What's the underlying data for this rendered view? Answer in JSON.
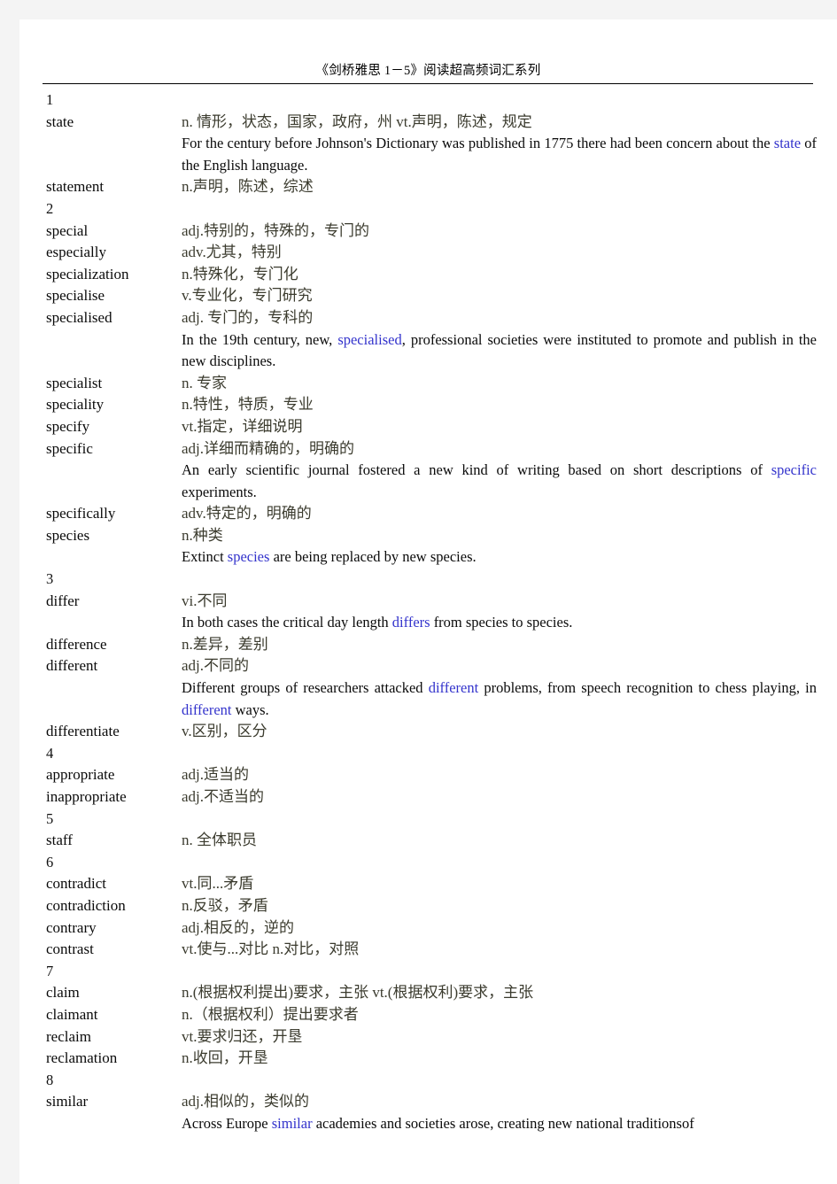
{
  "header": {
    "title": "《剑桥雅思 1－5》阅读超高频词汇系列"
  },
  "colors": {
    "page_background": "#ffffff",
    "outer_margin": "#f4f4f4",
    "highlight_word": "#3333cc",
    "chinese_definition": "#4a4a33",
    "body_text": "#0a0a0a"
  },
  "groups": [
    {
      "number": "1",
      "entries": [
        {
          "word": "state",
          "definition": "n. 情形，状态，国家，政府，州  vt.声明，陈述，规定",
          "examples": [
            {
              "before": "For the century before Johnson's Dictionary was published in 1775 there had been concern about the ",
              "highlight": "state",
              "after": " of the English language.",
              "justify": true
            }
          ]
        },
        {
          "word": "statement",
          "definition": "n.声明，陈述，综述",
          "examples": []
        }
      ]
    },
    {
      "number": "2",
      "entries": [
        {
          "word": "special",
          "definition": "adj.特别的，特殊的，专门的",
          "examples": []
        },
        {
          "word": "especially",
          "definition": "adv.尤其，特别",
          "examples": []
        },
        {
          "word": "specialization",
          "definition": "n.特殊化，专门化",
          "examples": []
        },
        {
          "word": "specialise",
          "definition": "v.专业化，专门研究",
          "examples": []
        },
        {
          "word": "specialised",
          "definition": "adj. 专门的，专科的",
          "examples": [
            {
              "before": "In the 19th century, new, ",
              "highlight": "specialised",
              "after": ", professional societies were instituted to promote and publish in the new disciplines.",
              "justify": true
            }
          ]
        },
        {
          "word": "specialist",
          "definition": "n. 专家",
          "examples": []
        },
        {
          "word": "speciality",
          "definition": "n.特性，特质，专业",
          "examples": []
        },
        {
          "word": "specify",
          "definition": "vt.指定，详细说明",
          "examples": []
        },
        {
          "word": "specific",
          "definition": "adj.详细而精确的，明确的",
          "examples": [
            {
              "before": "An early scientific journal fostered a new kind of writing based on short descriptions of ",
              "highlight": "specific",
              "after": " experiments.",
              "justify": true
            }
          ]
        },
        {
          "word": "specifically",
          "definition": "adv.特定的，明确的",
          "examples": []
        },
        {
          "word": "species",
          "definition": "n.种类",
          "examples": [
            {
              "before": "Extinct ",
              "highlight": "species",
              "after": " are being replaced by new species.",
              "justify": false
            }
          ]
        }
      ]
    },
    {
      "number": "3",
      "entries": [
        {
          "word": "differ",
          "definition": "vi.不同",
          "examples": [
            {
              "before": "In both cases the critical day length ",
              "highlight": "differs",
              "after": " from species to species.",
              "justify": false
            }
          ]
        },
        {
          "word": "difference",
          "definition": "n.差异，差别",
          "examples": []
        },
        {
          "word": "different",
          "definition": "adj.不同的",
          "examples": [
            {
              "before": "Different groups of researchers attacked ",
              "highlight": "different",
              "after": " problems, from speech recognition to chess playing, in ",
              "highlight2": "different",
              "after2": " ways.",
              "justify": true
            }
          ]
        },
        {
          "word": "differentiate",
          "definition": "v.区别，区分",
          "examples": []
        }
      ]
    },
    {
      "number": "4",
      "entries": [
        {
          "word": "appropriate",
          "definition": "adj.适当的",
          "examples": []
        },
        {
          "word": "inappropriate",
          "definition": "adj.不适当的",
          "examples": []
        }
      ]
    },
    {
      "number": "5",
      "entries": [
        {
          "word": "staff",
          "definition": "n. 全体职员",
          "examples": []
        }
      ]
    },
    {
      "number": "6",
      "entries": [
        {
          "word": "contradict",
          "definition": "vt.同...矛盾",
          "examples": []
        },
        {
          "word": "contradiction",
          "definition": "n.反驳，矛盾",
          "examples": []
        },
        {
          "word": "contrary",
          "definition": "adj.相反的，逆的",
          "examples": []
        },
        {
          "word": "contrast",
          "definition": "vt.使与...对比  n.对比，对照",
          "examples": []
        }
      ]
    },
    {
      "number": "7",
      "entries": [
        {
          "word": "claim",
          "definition": "n.(根据权利提出)要求，主张  vt.(根据权利)要求，主张",
          "examples": []
        },
        {
          "word": "claimant",
          "definition": "n.（根据权利）提出要求者",
          "examples": []
        },
        {
          "word": "reclaim",
          "definition": "vt.要求归还，开垦",
          "examples": []
        },
        {
          "word": "reclamation",
          "definition": "n.收回，开垦",
          "examples": []
        }
      ]
    },
    {
      "number": "8",
      "entries": [
        {
          "word": "similar",
          "definition": "adj.相似的，类似的",
          "examples": [
            {
              "before": "Across Europe ",
              "highlight": "similar",
              "after": " academies and societies arose, creating new national traditionsof",
              "justify": false
            }
          ]
        }
      ]
    }
  ]
}
